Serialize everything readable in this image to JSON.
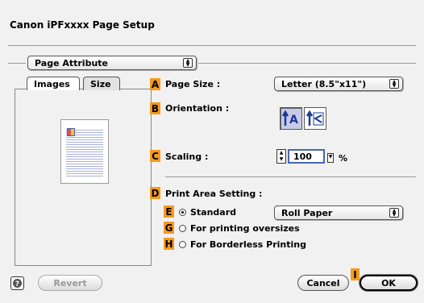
{
  "dialog": {
    "title": "Canon iPFxxxx Page Setup"
  },
  "section_popup": {
    "value": "Page Attribute"
  },
  "tabs": [
    {
      "label": "Images"
    },
    {
      "label": "Size"
    }
  ],
  "callouts": {
    "page_size": "A",
    "orientation": "B",
    "scaling": "C",
    "print_area": "D",
    "standard": "E",
    "oversizes": "G",
    "borderless": "H",
    "ok": "I"
  },
  "page_size": {
    "label": "Page Size :",
    "value": "Letter (8.5\"x11\")"
  },
  "orientation": {
    "label": "Orientation :"
  },
  "scaling": {
    "label": "Scaling :",
    "value": "100",
    "unit": "%"
  },
  "print_area": {
    "label": "Print Area Setting :",
    "options": [
      {
        "label": "Standard",
        "selected": true
      },
      {
        "label": "For printing oversizes",
        "selected": false
      },
      {
        "label": "For Borderless Printing",
        "selected": false
      }
    ],
    "paper_popup": "Roll Paper"
  },
  "footer": {
    "help_icon": "help-icon",
    "revert_label": "Revert",
    "cancel_label": "Cancel",
    "ok_label": "OK"
  },
  "colors": {
    "callout": "#f59a1a",
    "selected_icon": "#c8cbe8"
  }
}
